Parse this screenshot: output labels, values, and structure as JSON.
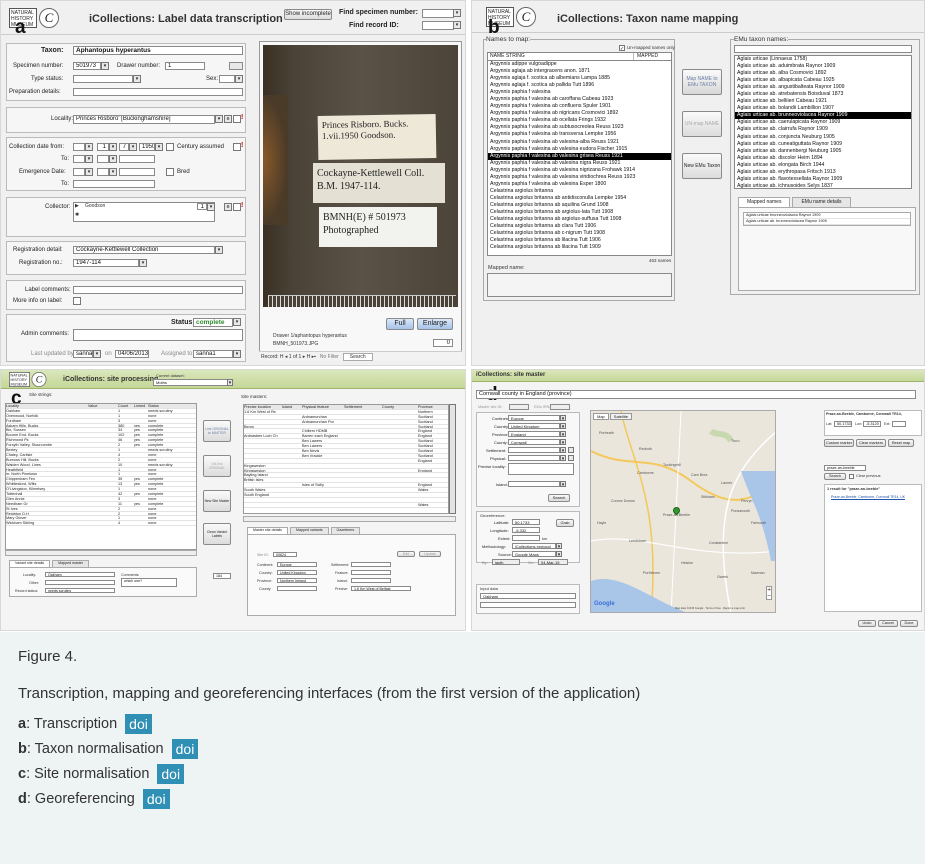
{
  "panel_a": {
    "letter": "a",
    "logo_text": "NATURAL HISTORY MUSEUM",
    "logo_symbol": "C",
    "title": "iCollections: Label data transcription",
    "show_incomplete_button": "Show incomplete",
    "find_specimen_label": "Find specimen number:",
    "find_record_label": "Find record ID:",
    "taxon_label": "Taxon:",
    "taxon_value": "Aphantopus hyperantus",
    "specimen_number_label": "Specimen number:",
    "specimen_number_value": "501973",
    "drawer_number_label": "Drawer number:",
    "drawer_number_value": "1",
    "type_status_label": "Type status:",
    "sex_label": "Sex:",
    "prep_details_label": "Preparation details:",
    "locality_label": "Locality:",
    "locality_value": "Princes Risboro' [Buckinghamshire]",
    "collection_date_label": "Collection date from:",
    "date_day": "1",
    "date_month": "7",
    "date_year": "1950",
    "century_assumed_label": "Century assumed",
    "to_label": "To:",
    "emergence_date_label": "Emergence Date:",
    "bred_label": "Bred",
    "collector_label": "Collector:",
    "collector_value": "Goodson",
    "collector_count": "1",
    "registration_detail_label": "Registration detail:",
    "registration_detail_value": "Cockayne-Kettlewell Collection",
    "registration_no_label": "Registration no.:",
    "registration_no_value": "1947-114",
    "label_comments_label": "Label comments:",
    "more_info_label": "More info on label:",
    "status_label": "Status:",
    "status_value": "complete",
    "admin_comments_label": "Admin comments:",
    "last_updated_label": "Last updated by",
    "last_updated_user": "sanna1",
    "on_label": "on",
    "last_updated_date": "04/06/2013",
    "assigned_label": "Assigned to:",
    "assigned_user": "sanna1",
    "specimen_labels": [
      "Princes Risboro. Bucks. 1.vii.1950 Goodson.",
      "Cockayne-Kettlewell Coll. B.M. 1947-114.",
      "BMNH(E) # 501973 Photographed"
    ],
    "full_button": "Full",
    "enlarge_button": "Enlarge",
    "image_caption": "Drawer 1/aphantopus hyperantus",
    "image_file": "BMNH_501973.JPG",
    "image_counter": "0",
    "record_nav": "Record: H ◂ 1 of 1 ▸ H ▸▪",
    "no_filter": "No Filter",
    "search_label": "Search"
  },
  "panel_b": {
    "letter": "b",
    "title": "iCollections: Taxon name mapping",
    "names_to_map_label": "Names to map:",
    "unmapped_only_label": "Un-mapped names only",
    "col_name_string": "NAME STRING",
    "col_mapped": "MAPPED",
    "names": [
      "Argynnis adippe vulgoadippe",
      "Argynnis aglaja ab intergracens anon. 1871",
      "Argynnis aglaja f. scotica ab albemians Lampa 1885",
      "Argynnis aglaja f. scotica ab pallida Tutt 1896",
      "Argynnis paphia f valesina",
      "Argynnis paphia f valesina ab caroffana Cabeau 1923",
      "Argynnis paphia f valesina ab confluens Spuler 1901",
      "Argynnis paphia f valesina ab nigricans Cosmovici 1892",
      "Argynnis paphia f valesina ab ocellata Frings 1932",
      "Argynnis paphia f valesina ab subtusocreolea Reuss 1923",
      "Argynnis paphia f valesina ab transversa Lempke 1956",
      "Argynnis paphia f valesina ab valesina-alba Reuss 1921",
      "Argynnis paphia f valesina ab valesina eudora Fischer 1915",
      "Argynnis paphia f valesina ab valesina grisea Reuss 1921",
      "Argynnis paphia f valesina ab valesina nigra Reuss 1921",
      "Argynnis paphia f valesina ab valesina nigrizana Frohawk 1914",
      "Argynnis paphia f valesina ab valesina viridiochrea Reuss 1923",
      "Argynnis paphia f valesina ab valesina Esper 1800",
      "Celastrina argiolus britanna",
      "Celastrina argiolus britanna ab antidisconulla Lempke 1954",
      "Celastrina argiolus britanna ab aquilina Grund 1908",
      "Celastrina argiolus britanna ab argiolus-lata Tutt 1908",
      "Celastrina argiolus britanna ab argiolus-suffusa Tutt 1908",
      "Celastrina argiolus britanna ab clara Tutt 1906",
      "Celastrina argiolus britanna ab c-nigrum Tutt 1908",
      "Celastrina argiolus britanna ab lilacina Tutt 1906",
      "Celastrina argiolus britanna ab lilacina Tutt 1909"
    ],
    "selected_name_index": 13,
    "names_count": "463 names",
    "map_button": "Map NAME to EMu TAXON",
    "unmap_button": "UN-map NAME",
    "new_taxon_button": "New EMu Taxon",
    "mapped_name_label": "Mapped name:",
    "emu_names_label": "EMu taxon names:",
    "emu_names": [
      "Aglais urticae (Linnaeus 1758)",
      "Aglais urticae ab. aduimbrata Raynor 1909",
      "Aglais urticae ab. alba Cosmovici 1892",
      "Aglais urticae ab. albapicata Cabeau 1925",
      "Aglais urticae ab. angustibalteata Raynor 1909",
      "Aglais urticae ab. atrebatensis Boisduval 1873",
      "Aglais urticae ab. belliieri Cabeau 1921",
      "Aglais urticae ab. bolandii Lambillion 1907",
      "Aglais urticae ab. brunneoviolacea Raynor 1909",
      "Aglais urticae ab. caerulapicata Raynor 1909",
      "Aglais urticae ab. clairrufa Raynor 1909",
      "Aglais urticae ab. conjuncta Neuburg 1905",
      "Aglais urticae ab. cuneatiguttata Raynor 1909",
      "Aglais urticae ab. dannenbergi Neuburg 1905",
      "Aglais urticae ab. discolor Heim 1894",
      "Aglais urticae ab. elongata Birch 1944",
      "Aglais urticae ab. erythropasa Fritsch 1913",
      "Aglais urticae ab. flavotessellata Raynor 1909",
      "Aglais urticae ab. ichnusoides Selys 1837"
    ],
    "selected_emu_index": 8,
    "tab_mapped": "Mapped names",
    "tab_details": "EMu name details",
    "mapped_rows": [
      "Aglais urticae brunneoviolacea Raynor 1909",
      "Aglais urticae ab. brunneoviolacea Raynor 1909"
    ]
  },
  "panel_c": {
    "letter": "c",
    "title": "iCollections: site processing",
    "current_dataset_label": "Current dataset:",
    "current_dataset_value": "Moths",
    "site_strings_label": "Site strings:",
    "site_masters_label": "Site masters:",
    "left_columns": [
      "Locality",
      "Value",
      "Count",
      "Linked",
      "Status"
    ],
    "left_rows": [
      [
        "Oakham",
        "",
        "1",
        "",
        "needs scrutiny"
      ],
      [
        "Oxenwood, Norfolk",
        "",
        "1",
        "",
        "none"
      ],
      [
        "Fordham",
        "",
        "3",
        "",
        "none"
      ],
      [
        "Askam Hills, Bucks",
        "",
        "380",
        "yes",
        "complete"
      ],
      [
        "Bix, Sussex",
        "",
        "34",
        "yes",
        "complete"
      ],
      [
        "Bourne End, Bucks",
        "",
        "102",
        "yes",
        "complete"
      ],
      [
        "Richmond Pk",
        "",
        "46",
        "yes",
        "complete"
      ],
      [
        "Forsyth Valley, Stourcombe",
        "",
        "2",
        "yes",
        "complete"
      ],
      [
        "Bexley",
        "",
        "1",
        "",
        "needs scrutiny"
      ],
      [
        "Chaley, Carlisle",
        "",
        "4",
        "",
        "none"
      ],
      [
        "Burrows Hill, Bucks",
        "",
        "2",
        "",
        "none"
      ],
      [
        "Walden Wood, Lines",
        "",
        "10",
        "",
        "needs scrutiny"
      ],
      [
        "Heathfield",
        "",
        "1",
        "",
        "none"
      ],
      [
        "nr. North Pinetown",
        "",
        "1",
        "",
        "none"
      ],
      [
        "Chippenham Fen",
        "",
        "35",
        "yes",
        "complete"
      ],
      [
        "Whittlesford, Wilts",
        "",
        "13",
        "yes",
        "complete"
      ],
      [
        "O'Livingston, Kilmelsey",
        "",
        "1",
        "",
        "none"
      ],
      [
        "Tottenhall",
        "",
        "42",
        "yes",
        "complete"
      ],
      [
        "Glen Annie",
        "",
        "3",
        "",
        "none"
      ],
      [
        "Needham Gr",
        "",
        "11",
        "yes",
        "complete"
      ],
      [
        "St Ives",
        "",
        "2",
        "",
        "none"
      ],
      [
        "Reighton D.H",
        "",
        "2",
        "",
        "none"
      ],
      [
        "Mary Glover",
        "",
        "1",
        "",
        "none"
      ],
      [
        "Wickham Sibling",
        "",
        "4",
        "",
        "none"
      ]
    ],
    "link_button": "Link ORIGINAL to MASTER",
    "unlink_button": "UN-link ORIGINAL",
    "new_master_button": "New Site Master",
    "clean_button": "Clean Variant Labels",
    "right_columns": [
      "Precise location",
      "Island",
      "Physical feature",
      "Settlement",
      "County",
      "Province"
    ],
    "right_rows": [
      [
        "1.6 Km West of Re",
        "",
        "",
        "",
        "",
        "Northern"
      ],
      [
        "",
        "",
        "Ardnamurchan",
        "",
        "",
        "Scotland"
      ],
      [
        "",
        "",
        "Ardnamurchan Por",
        "",
        "",
        "Scotland"
      ],
      [
        "Berns",
        "",
        "",
        "",
        "",
        "Scotland"
      ],
      [
        "",
        "",
        "Chiltern HDMB",
        "",
        "",
        "England"
      ],
      [
        "Ardnasbee Loch Ch",
        "",
        "Barren each England",
        "",
        "",
        "England"
      ],
      [
        "",
        "",
        "Ben Lawers",
        "",
        "",
        "Scotland"
      ],
      [
        "",
        "",
        "Ben Lawers",
        "",
        "",
        "Scotland"
      ],
      [
        "",
        "",
        "Ben Nevis",
        "",
        "",
        "Scotland"
      ],
      [
        "",
        "",
        "Ben Vrackie",
        "",
        "",
        "Scotland"
      ],
      [
        "",
        "",
        "",
        "",
        "",
        "England"
      ],
      [
        "Kingsweston",
        "",
        "",
        "",
        "",
        ""
      ],
      [
        "Kingsweston",
        "",
        "",
        "",
        "",
        "England"
      ],
      [
        "Bayling Island",
        "",
        "",
        "",
        "",
        ""
      ],
      [
        "British Isles",
        "",
        "",
        "",
        "",
        ""
      ],
      [
        "",
        "",
        "Isles of Scilly",
        "",
        "",
        "England"
      ],
      [
        "South Wales",
        "",
        "",
        "",
        "",
        "Wales"
      ],
      [
        "South England",
        "",
        "",
        "",
        "",
        ""
      ],
      [
        "",
        "",
        "",
        "",
        "",
        ""
      ],
      [
        "",
        "",
        "",
        "",
        "",
        "Wales"
      ]
    ],
    "tab_master_details": "Master site details",
    "tab_mapped_variants": "Mapped variants",
    "tab_gazetteers": "Gazetteers",
    "variant_tab_details": "Variant site details",
    "variant_tab_master": "Mapped master",
    "locality_label": "Locality:",
    "locality_value": "Oakham",
    "comments_label": "Comments:",
    "comments_value": "which one?",
    "other_label": "Other:",
    "record_status_label": "Record status:",
    "record_status_value": "needs scrutiny",
    "master_site_id_label": "Site ID:",
    "master_site_id_value": "00624",
    "continent_label": "Continent:",
    "continent_value": "Europe",
    "country_label": "Country:",
    "country_value": "United Kingdom",
    "province_label": "Province:",
    "province_value": "Northern Ireland",
    "county_label": "County:",
    "settlement_label": "Settlement:",
    "feature_label": "Feature:",
    "island_label": "Island:",
    "precise_label": "Precise:",
    "precise_value": "1.6 Km West of Belfast",
    "edit_button": "Edit",
    "update_button": "Update",
    "count_value": "184"
  },
  "panel_d": {
    "letter": "d",
    "title": "iCollections: site master",
    "locality_value": "Cornwall county in England (province)",
    "master_site_id_label": "Master site ID:",
    "emu_id_label": "EMu IRN:",
    "continent_label": "Continent:",
    "continent_value": "Europe",
    "country_label": "Country:",
    "country_value": "United Kingdom",
    "province_label": "Province:",
    "province_value": "England",
    "county_label": "County:",
    "county_value": "Cornwall",
    "settlement_label": "Settlement:",
    "physical_label": "Physical:",
    "precise_label": "Precise locality:",
    "island_label": "Island:",
    "search_button": "Search",
    "georeference_label": "Georeference:",
    "latitude_label": "Latitude:",
    "latitude_value": "50.1733",
    "longitude_label": "Longitude:",
    "longitude_value": "-5.332",
    "extent_label": "Extent:",
    "extent_unit": "km",
    "grab_button": "Grab",
    "methodology_label": "Methodology:",
    "methodology_value": "iCollections protocol",
    "source_label": "Source:",
    "source_value": "Google Maps",
    "by_label": "By:",
    "by_value": "jacth",
    "on_label": "On:",
    "on_value": "04-Mar-15",
    "input_data_label": "Input data",
    "input_data_value": "Oakham",
    "map_tab_map": "Map",
    "map_tab_satellite": "Satellite",
    "map_places": [
      "Portreath",
      "Redruth",
      "Camborne",
      "Tuckingmill",
      "Connor Downs",
      "Hayle",
      "Praze-an-Beeble",
      "Helston",
      "Porthleven",
      "Truro",
      "Stithians",
      "Penryn",
      "Falmouth",
      "Constantine",
      "Gweek",
      "Leedstown",
      "Carn Brea",
      "Lanner",
      "Ponsanooth",
      "Mawnan"
    ],
    "map_copyright": "Map data ©2015 Google · Terms of Use · Report a map error",
    "google_label": "Google",
    "place_title": "Praze-an-Beeble, Camborne, Cornwall TR14,",
    "lat_label": "Lat:",
    "lat_value": "50.1733",
    "lon_label": "Lon:",
    "lon_value": "-5.3120",
    "ext_label": "Ext:",
    "custom_marker_button": "Custom marker",
    "clear_markers_button": "Clear markers",
    "reset_map_button": "Reset map",
    "search_input_value": "praze-an-beeble",
    "search_button2": "Search",
    "clear_previous_label": "Clear previous",
    "result_header": "1 result for \"praze-an-beeble\"",
    "result_item": "Praze-an-Beeble, Camborne, Cornwall TR14, UK",
    "undo_button": "Undo",
    "cancel_button": "Cancel",
    "done_button": "Done"
  },
  "caption": {
    "figure": "Figure 4.",
    "text": "Transcription, mapping and georeferencing interfaces (from the first version of the application)",
    "items": [
      {
        "key": "a",
        "label": ": Transcription",
        "doi": "doi"
      },
      {
        "key": "b",
        "label": ": Taxon normalisation",
        "doi": "doi"
      },
      {
        "key": "c",
        "label": ": Site normalisation",
        "doi": "doi"
      },
      {
        "key": "d",
        "label": ": Georeferencing",
        "doi": "doi"
      }
    ]
  },
  "colors": {
    "header_green": "#c4d797",
    "status_green": "#2e8b2e",
    "doi_blue": "#2f8fb4",
    "caption_bg": "#eef3f4",
    "marker_red": "#cc2222"
  }
}
